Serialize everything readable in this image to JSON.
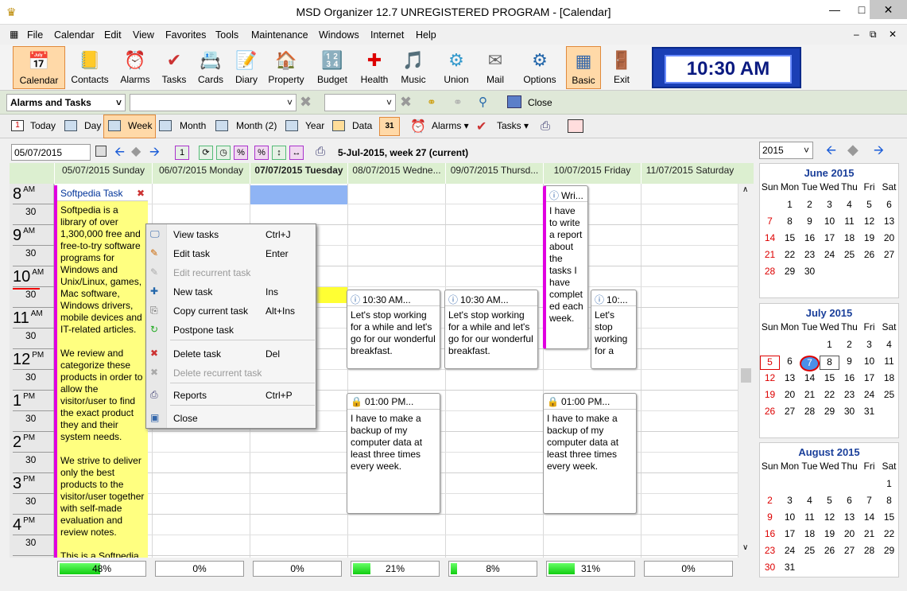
{
  "window": {
    "title": "MSD Organizer 12.7 UNREGISTERED PROGRAM - [Calendar]"
  },
  "menu": [
    "File",
    "Calendar",
    "Edit",
    "View",
    "Favorites",
    "Tools",
    "Maintenance",
    "Windows",
    "Internet",
    "Help"
  ],
  "toolbar": [
    "Calendar",
    "Contacts",
    "Alarms",
    "Tasks",
    "Cards",
    "Diary",
    "Property",
    "Budget",
    "Health",
    "Music",
    "Union",
    "Mail",
    "Options",
    "Basic",
    "Exit"
  ],
  "clock": "10:30 AM",
  "bar2": {
    "category": "Alarms and Tasks",
    "close": "Close"
  },
  "bar3": {
    "today": "Today",
    "day": "Day",
    "week": "Week",
    "month": "Month",
    "month2": "Month (2)",
    "year": "Year",
    "data": "Data",
    "alarms": "Alarms",
    "tasks": "Tasks"
  },
  "calhead": {
    "date": "05/07/2015",
    "info": "5-Jul-2015, week 27 (current)"
  },
  "days": [
    "05/07/2015 Sunday",
    "06/07/2015 Monday",
    "07/07/2015 Tuesday",
    "08/07/2015 Wedne...",
    "09/07/2015 Thursd...",
    "10/07/2015 Friday",
    "11/07/2015 Saturday"
  ],
  "hours": [
    {
      "h": "8",
      "ap": "AM"
    },
    {
      "h": "9",
      "ap": "AM"
    },
    {
      "h": "10",
      "ap": "AM"
    },
    {
      "h": "11",
      "ap": "AM"
    },
    {
      "h": "12",
      "ap": "PM"
    },
    {
      "h": "1",
      "ap": "PM"
    },
    {
      "h": "2",
      "ap": "PM"
    },
    {
      "h": "3",
      "ap": "PM"
    },
    {
      "h": "4",
      "ap": "PM"
    }
  ],
  "half": "30",
  "softpedia": {
    "title": "Softpedia Task",
    "body": "Softpedia is a library of over 1,300,000 free and free-to-try software programs for Windows and Unix/Linux, games, Mac software, Windows drivers, mobile devices and IT-related articles.\n\nWe review and categorize these products in order to allow the visitor/user to find the exact product they and their system needs.\n\nWe strive to deliver only the best products to the visitor/user together with self-made evaluation and review notes.\n\nThis is a Softpedia"
  },
  "tasks": {
    "wri_title": "Wri...",
    "wri_body": "I have to write a report about the tasks I have complet ed each week.",
    "stop_title": "10:30 AM...",
    "stop_body": "Let's stop working for a while and let's go for our wonderful breakfast.",
    "stop_short_title": "10:...",
    "stop_short_body": "Let's stop working for a",
    "backup_title": "01:00 PM...",
    "backup_body": "I have to make a backup of my computer data at least three times every week."
  },
  "context_menu": [
    {
      "label": "View tasks",
      "key": "Ctrl+J",
      "dis": false
    },
    {
      "label": "Edit task",
      "key": "Enter",
      "dis": false
    },
    {
      "label": "Edit recurrent task",
      "key": "",
      "dis": true
    },
    {
      "label": "New task",
      "key": "Ins",
      "dis": false
    },
    {
      "label": "Copy current task",
      "key": "Alt+Ins",
      "dis": false
    },
    {
      "label": "Postpone task",
      "key": "",
      "dis": false
    },
    {
      "label": "Delete task",
      "key": "Del",
      "dis": false
    },
    {
      "label": "Delete recurrent task",
      "key": "",
      "dis": true
    },
    {
      "label": "Reports",
      "key": "Ctrl+P",
      "dis": false
    },
    {
      "label": "Close",
      "key": "",
      "dis": false
    }
  ],
  "progress": [
    {
      "label": "48%",
      "value": 0.48
    },
    {
      "label": "0%",
      "value": 0
    },
    {
      "label": "0%",
      "value": 0
    },
    {
      "label": "21%",
      "value": 0.21
    },
    {
      "label": "8%",
      "value": 0.08
    },
    {
      "label": "31%",
      "value": 0.31
    },
    {
      "label": "0%",
      "value": 0
    }
  ],
  "year": "2015",
  "weekdays": [
    "Sun",
    "Mon",
    "Tue",
    "Wed",
    "Thu",
    "Fri",
    "Sat"
  ],
  "months": [
    {
      "name": "June 2015",
      "start": 1,
      "days": 30
    },
    {
      "name": "July 2015",
      "start": 3,
      "days": 31
    },
    {
      "name": "August 2015",
      "start": 6,
      "days": 31
    }
  ]
}
